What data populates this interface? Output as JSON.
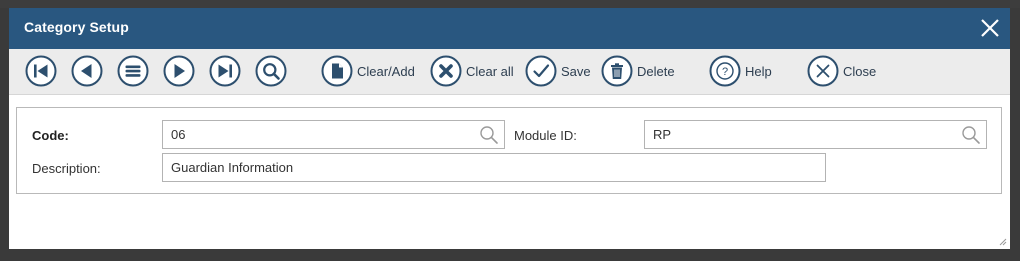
{
  "dialog": {
    "title": "Category Setup"
  },
  "toolbar": {
    "first_icon": "first-record-icon",
    "prev_icon": "previous-record-icon",
    "list_icon": "list-icon",
    "next_icon": "next-record-icon",
    "last_icon": "last-record-icon",
    "find_icon": "search-icon",
    "clear_add": "Clear/Add",
    "clear_all": "Clear all",
    "save": "Save",
    "delete": "Delete",
    "help": "Help",
    "close": "Close"
  },
  "form": {
    "code_label": "Code:",
    "code_value": "06",
    "module_label": "Module ID:",
    "module_value": "RP",
    "description_label": "Description:",
    "description_value": "Guardian Information"
  },
  "colors": {
    "titlebar": "#295780",
    "icon": "#2d4f6e",
    "toolbar_bg": "#ececec"
  }
}
